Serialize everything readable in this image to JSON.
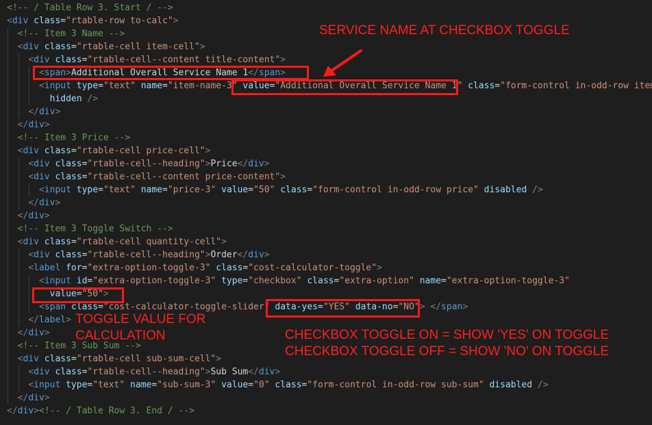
{
  "code_lines": [
    [
      [
        "c",
        "<!-- / Table Row 3. Start / -->"
      ]
    ],
    [
      [
        "b",
        "<"
      ],
      [
        "t",
        "div"
      ],
      [
        "x",
        " "
      ],
      [
        "a",
        "class"
      ],
      [
        "x",
        "="
      ],
      [
        "s",
        "\"rtable-row to-calc\""
      ],
      [
        "b",
        ">"
      ]
    ],
    [
      [
        "x",
        "  "
      ],
      [
        "c",
        "<!-- Item 3 Name -->"
      ]
    ],
    [
      [
        "x",
        "  "
      ],
      [
        "b",
        "<"
      ],
      [
        "t",
        "div"
      ],
      [
        "x",
        " "
      ],
      [
        "a",
        "class"
      ],
      [
        "x",
        "="
      ],
      [
        "s",
        "\"rtable-cell item-cell\""
      ],
      [
        "b",
        ">"
      ]
    ],
    [
      [
        "x",
        "    "
      ],
      [
        "b",
        "<"
      ],
      [
        "t",
        "div"
      ],
      [
        "x",
        " "
      ],
      [
        "a",
        "class"
      ],
      [
        "x",
        "="
      ],
      [
        "s",
        "\"rtable-cell--content title-content\""
      ],
      [
        "b",
        ">"
      ]
    ],
    [
      [
        "x",
        "      "
      ],
      [
        "b",
        "<"
      ],
      [
        "t",
        "span"
      ],
      [
        "b",
        ">"
      ],
      [
        "x",
        "Additional Overall Service Name 1"
      ],
      [
        "b",
        "</"
      ],
      [
        "t",
        "span"
      ],
      [
        "b",
        ">"
      ]
    ],
    [
      [
        "x",
        "      "
      ],
      [
        "b",
        "<"
      ],
      [
        "t",
        "input"
      ],
      [
        "x",
        " "
      ],
      [
        "a",
        "type"
      ],
      [
        "x",
        "="
      ],
      [
        "s",
        "\"text\""
      ],
      [
        "x",
        " "
      ],
      [
        "a",
        "name"
      ],
      [
        "x",
        "="
      ],
      [
        "s",
        "\"item-name-3\""
      ],
      [
        "x",
        " "
      ],
      [
        "a",
        "value"
      ],
      [
        "x",
        "="
      ],
      [
        "s",
        "\"Additional Overall Service Name 1\""
      ],
      [
        "x",
        " "
      ],
      [
        "a",
        "class"
      ],
      [
        "x",
        "="
      ],
      [
        "s",
        "\"form-control in-odd-row item-n"
      ]
    ],
    [
      [
        "x",
        "        "
      ],
      [
        "a",
        "hidden"
      ],
      [
        "x",
        " "
      ],
      [
        "b",
        "/>"
      ]
    ],
    [
      [
        "x",
        "    "
      ],
      [
        "b",
        "</"
      ],
      [
        "t",
        "div"
      ],
      [
        "b",
        ">"
      ]
    ],
    [
      [
        "x",
        "  "
      ],
      [
        "b",
        "</"
      ],
      [
        "t",
        "div"
      ],
      [
        "b",
        ">"
      ]
    ],
    [
      [
        "x",
        "  "
      ],
      [
        "c",
        "<!-- Item 3 Price -->"
      ]
    ],
    [
      [
        "x",
        "  "
      ],
      [
        "b",
        "<"
      ],
      [
        "t",
        "div"
      ],
      [
        "x",
        " "
      ],
      [
        "a",
        "class"
      ],
      [
        "x",
        "="
      ],
      [
        "s",
        "\"rtable-cell price-cell\""
      ],
      [
        "b",
        ">"
      ]
    ],
    [
      [
        "x",
        "    "
      ],
      [
        "b",
        "<"
      ],
      [
        "t",
        "div"
      ],
      [
        "x",
        " "
      ],
      [
        "a",
        "class"
      ],
      [
        "x",
        "="
      ],
      [
        "s",
        "\"rtable-cell--heading\""
      ],
      [
        "b",
        ">"
      ],
      [
        "x",
        "Price"
      ],
      [
        "b",
        "</"
      ],
      [
        "t",
        "div"
      ],
      [
        "b",
        ">"
      ]
    ],
    [
      [
        "x",
        "    "
      ],
      [
        "b",
        "<"
      ],
      [
        "t",
        "div"
      ],
      [
        "x",
        " "
      ],
      [
        "a",
        "class"
      ],
      [
        "x",
        "="
      ],
      [
        "s",
        "\"rtable-cell--content price-content\""
      ],
      [
        "b",
        ">"
      ]
    ],
    [
      [
        "x",
        "      "
      ],
      [
        "b",
        "<"
      ],
      [
        "t",
        "input"
      ],
      [
        "x",
        " "
      ],
      [
        "a",
        "type"
      ],
      [
        "x",
        "="
      ],
      [
        "s",
        "\"text\""
      ],
      [
        "x",
        " "
      ],
      [
        "a",
        "name"
      ],
      [
        "x",
        "="
      ],
      [
        "s",
        "\"price-3\""
      ],
      [
        "x",
        " "
      ],
      [
        "a",
        "value"
      ],
      [
        "x",
        "="
      ],
      [
        "s",
        "\"50\""
      ],
      [
        "x",
        " "
      ],
      [
        "a",
        "class"
      ],
      [
        "x",
        "="
      ],
      [
        "s",
        "\"form-control in-odd-row price\""
      ],
      [
        "x",
        " "
      ],
      [
        "a",
        "disabled"
      ],
      [
        "x",
        " "
      ],
      [
        "b",
        "/>"
      ]
    ],
    [
      [
        "x",
        "    "
      ],
      [
        "b",
        "</"
      ],
      [
        "t",
        "div"
      ],
      [
        "b",
        ">"
      ]
    ],
    [
      [
        "x",
        "  "
      ],
      [
        "b",
        "</"
      ],
      [
        "t",
        "div"
      ],
      [
        "b",
        ">"
      ]
    ],
    [
      [
        "x",
        "  "
      ],
      [
        "c",
        "<!-- Item 3 Toggle Switch -->"
      ]
    ],
    [
      [
        "x",
        "  "
      ],
      [
        "b",
        "<"
      ],
      [
        "t",
        "div"
      ],
      [
        "x",
        " "
      ],
      [
        "a",
        "class"
      ],
      [
        "x",
        "="
      ],
      [
        "s",
        "\"rtable-cell quantity-cell\""
      ],
      [
        "b",
        ">"
      ]
    ],
    [
      [
        "x",
        "    "
      ],
      [
        "b",
        "<"
      ],
      [
        "t",
        "div"
      ],
      [
        "x",
        " "
      ],
      [
        "a",
        "class"
      ],
      [
        "x",
        "="
      ],
      [
        "s",
        "\"rtable-cell--heading\""
      ],
      [
        "b",
        ">"
      ],
      [
        "x",
        "Order"
      ],
      [
        "b",
        "</"
      ],
      [
        "t",
        "div"
      ],
      [
        "b",
        ">"
      ]
    ],
    [
      [
        "x",
        "    "
      ],
      [
        "b",
        "<"
      ],
      [
        "t",
        "label"
      ],
      [
        "x",
        " "
      ],
      [
        "a",
        "for"
      ],
      [
        "x",
        "="
      ],
      [
        "s",
        "\"extra-option-toggle-3\""
      ],
      [
        "x",
        " "
      ],
      [
        "a",
        "class"
      ],
      [
        "x",
        "="
      ],
      [
        "s",
        "\"cost-calculator-toggle\""
      ],
      [
        "b",
        ">"
      ]
    ],
    [
      [
        "x",
        "      "
      ],
      [
        "b",
        "<"
      ],
      [
        "t",
        "input"
      ],
      [
        "x",
        " "
      ],
      [
        "a",
        "id"
      ],
      [
        "x",
        "="
      ],
      [
        "s",
        "\"extra-option-toggle-3\""
      ],
      [
        "x",
        " "
      ],
      [
        "a",
        "type"
      ],
      [
        "x",
        "="
      ],
      [
        "s",
        "\"checkbox\""
      ],
      [
        "x",
        " "
      ],
      [
        "a",
        "class"
      ],
      [
        "x",
        "="
      ],
      [
        "s",
        "\"extra-option\""
      ],
      [
        "x",
        " "
      ],
      [
        "a",
        "name"
      ],
      [
        "x",
        "="
      ],
      [
        "s",
        "\"extra-option-toggle-3\""
      ]
    ],
    [
      [
        "x",
        "        "
      ],
      [
        "a",
        "value"
      ],
      [
        "x",
        "="
      ],
      [
        "s",
        "\"50\""
      ],
      [
        "b",
        ">"
      ]
    ],
    [
      [
        "x",
        "      "
      ],
      [
        "b",
        "<"
      ],
      [
        "t",
        "span"
      ],
      [
        "x",
        " "
      ],
      [
        "a",
        "class"
      ],
      [
        "x",
        "="
      ],
      [
        "s",
        "\"cost-calculator-toggle-slider\""
      ],
      [
        "x",
        " "
      ],
      [
        "a",
        "data-yes"
      ],
      [
        "x",
        "="
      ],
      [
        "s",
        "\"YES\""
      ],
      [
        "x",
        " "
      ],
      [
        "a",
        "data-no"
      ],
      [
        "x",
        "="
      ],
      [
        "s",
        "\"NO\""
      ],
      [
        "b",
        ">"
      ],
      [
        "x",
        " "
      ],
      [
        "b",
        "</"
      ],
      [
        "t",
        "span"
      ],
      [
        "b",
        ">"
      ]
    ],
    [
      [
        "x",
        "    "
      ],
      [
        "b",
        "</"
      ],
      [
        "t",
        "label"
      ],
      [
        "b",
        ">"
      ]
    ],
    [
      [
        "x",
        "  "
      ],
      [
        "b",
        "</"
      ],
      [
        "t",
        "div"
      ],
      [
        "b",
        ">"
      ]
    ],
    [
      [
        "x",
        "  "
      ],
      [
        "c",
        "<!-- Item 3 Sub Sum -->"
      ]
    ],
    [
      [
        "x",
        "  "
      ],
      [
        "b",
        "<"
      ],
      [
        "t",
        "div"
      ],
      [
        "x",
        " "
      ],
      [
        "a",
        "class"
      ],
      [
        "x",
        "="
      ],
      [
        "s",
        "\"rtable-cell sub-sum-cell\""
      ],
      [
        "b",
        ">"
      ]
    ],
    [
      [
        "x",
        "    "
      ],
      [
        "b",
        "<"
      ],
      [
        "t",
        "div"
      ],
      [
        "x",
        " "
      ],
      [
        "a",
        "class"
      ],
      [
        "x",
        "="
      ],
      [
        "s",
        "\"rtable-cell--heading\""
      ],
      [
        "b",
        ">"
      ],
      [
        "x",
        "Sub Sum"
      ],
      [
        "b",
        "</"
      ],
      [
        "t",
        "div"
      ],
      [
        "b",
        ">"
      ]
    ],
    [
      [
        "x",
        "    "
      ],
      [
        "b",
        "<"
      ],
      [
        "t",
        "input"
      ],
      [
        "x",
        " "
      ],
      [
        "a",
        "type"
      ],
      [
        "x",
        "="
      ],
      [
        "s",
        "\"text\""
      ],
      [
        "x",
        " "
      ],
      [
        "a",
        "name"
      ],
      [
        "x",
        "="
      ],
      [
        "s",
        "\"sub-sum-3\""
      ],
      [
        "x",
        " "
      ],
      [
        "a",
        "value"
      ],
      [
        "x",
        "="
      ],
      [
        "s",
        "\"0\""
      ],
      [
        "x",
        " "
      ],
      [
        "a",
        "class"
      ],
      [
        "x",
        "="
      ],
      [
        "s",
        "\"form-control in-odd-row sub-sum\""
      ],
      [
        "x",
        " "
      ],
      [
        "a",
        "disabled"
      ],
      [
        "x",
        " "
      ],
      [
        "b",
        "/>"
      ]
    ],
    [
      [
        "x",
        "  "
      ],
      [
        "b",
        "</"
      ],
      [
        "t",
        "div"
      ],
      [
        "b",
        ">"
      ]
    ],
    [
      [
        "b",
        "</"
      ],
      [
        "t",
        "div"
      ],
      [
        "b",
        ">"
      ],
      [
        "c",
        "<!-- / Table Row 3. End / -->"
      ]
    ]
  ],
  "annotations": {
    "service_name_title": "SERVICE NAME AT CHECKBOX TOGGLE",
    "toggle_value_line1": "TOGGLE VALUE FOR",
    "toggle_value_line2": "CALCULATION",
    "checkbox_on": "CHECKBOX TOGGLE ON = SHOW 'YES' ON TOGGLE",
    "checkbox_off": "CHECKBOX TOGGLE OFF = SHOW 'NO' ON TOGGLE"
  },
  "colors": {
    "background": "#1e1e1e",
    "comment": "#6a9955",
    "tag": "#569cd6",
    "attribute": "#9cdcfe",
    "string": "#ce9178",
    "annotation": "#ff1a1a"
  }
}
